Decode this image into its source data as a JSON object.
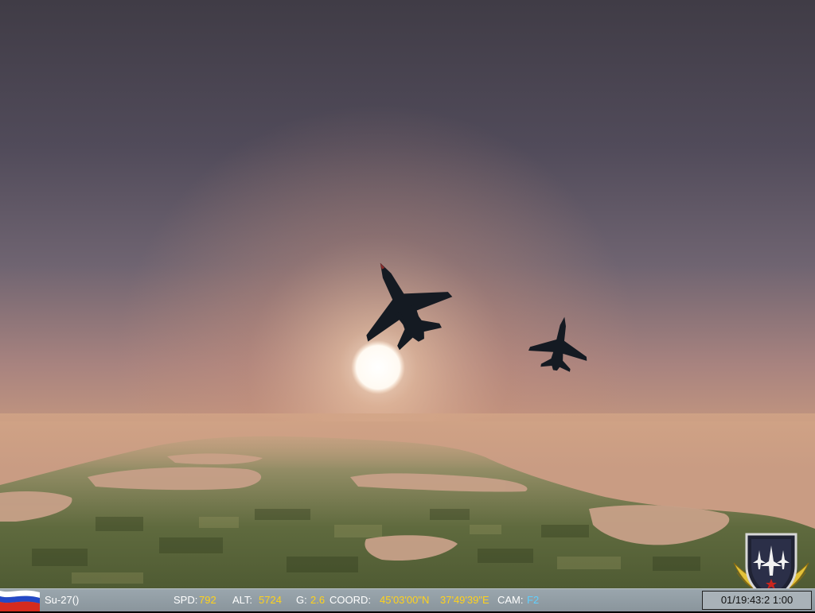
{
  "hud": {
    "aircraft": "Su-27()",
    "speed_label": "SPD:",
    "speed_value": "792",
    "altitude_label": "ALT:",
    "altitude_value": "5724",
    "g_label": "G:",
    "g_value": "2.6",
    "coord_label": "COORD:",
    "latitude": "45'03'00\"N",
    "longitude": "37'49'39\"E",
    "camera_label": "CAM:",
    "camera_value": "F2",
    "clock": "01/19:43:2  1:00"
  },
  "icons": {
    "flag": "russian-flag-icon",
    "emblem": "squadron-emblem-icon"
  },
  "colors": {
    "hud_bar": "#8f9aa1",
    "value_yellow": "#ffd21a",
    "camera_blue": "#5fd0ff",
    "sky_top": "#3f3c46",
    "horizon_glow": "#d8a07e"
  }
}
